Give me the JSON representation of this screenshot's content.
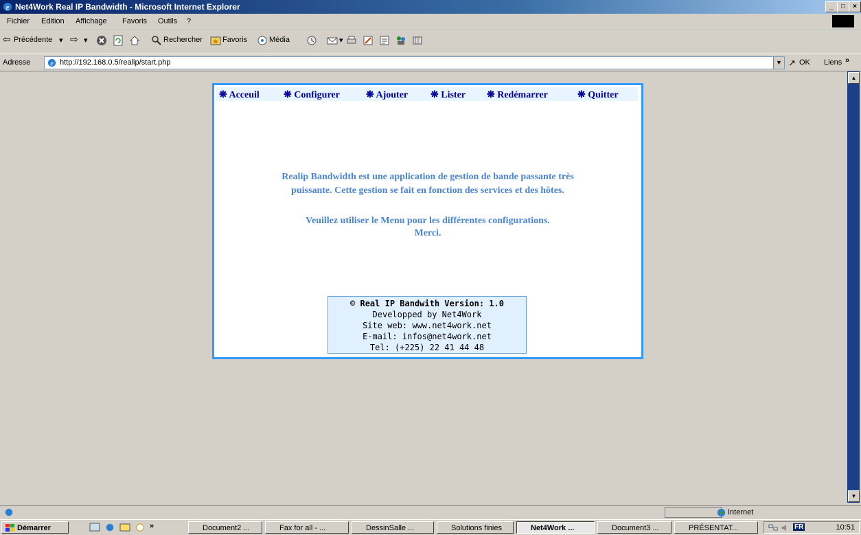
{
  "window": {
    "title": "Net4Work Real IP Bandwidth - Microsoft Internet Explorer",
    "buttons": [
      "_",
      "□",
      "×"
    ]
  },
  "menubar": {
    "items": [
      "Fichier",
      "Edition",
      "Affichage",
      "Favoris",
      "Outils",
      "?"
    ]
  },
  "toolbar": {
    "back_label": "Précédente",
    "search_label": "Rechercher",
    "favorites_label": "Favoris",
    "media_label": "Média"
  },
  "address": {
    "label": "Adresse",
    "url": "http://192.168.0.5/realip/start.php",
    "go_label": "OK",
    "links_label": "Liens"
  },
  "page": {
    "nav": [
      "Acceuil",
      "Configurer",
      "Ajouter",
      "Lister",
      "Redémarrer",
      "Quitter"
    ],
    "desc_line1": "Realip Bandwidth est une application de gestion de bande passante très",
    "desc_line2": "puissante. Cette gestion se fait en fonction des services et des hôtes.",
    "desc_line3": "Veuillez utiliser le Menu pour les différentes configurations.",
    "desc_line4": "Merci.",
    "footer": {
      "line1": "© Real IP Bandwith Version: 1.0",
      "line2": "Developped by Net4Work",
      "line3": "Site web: www.net4work.net",
      "line4": "E-mail: infos@net4work.net",
      "line5": "Tel: (+225) 22 41 44 48"
    }
  },
  "statusbar": {
    "zone": "Internet"
  },
  "taskbar": {
    "start_label": "Démarrer",
    "more": "»",
    "tasks": [
      "Document2 ...",
      "Fax for all - ...",
      "DessinSalle ...",
      "Solutions finies",
      "Net4Work ...",
      "Document3 ...",
      "PRÉSENTAT..."
    ],
    "lang": "FR",
    "clock": "10:51"
  },
  "colors": {
    "panel_border": "#3399ff",
    "nav_text": "#00009c",
    "desc_text": "#4a86d6",
    "title_gradient_start": "#0a246a"
  }
}
